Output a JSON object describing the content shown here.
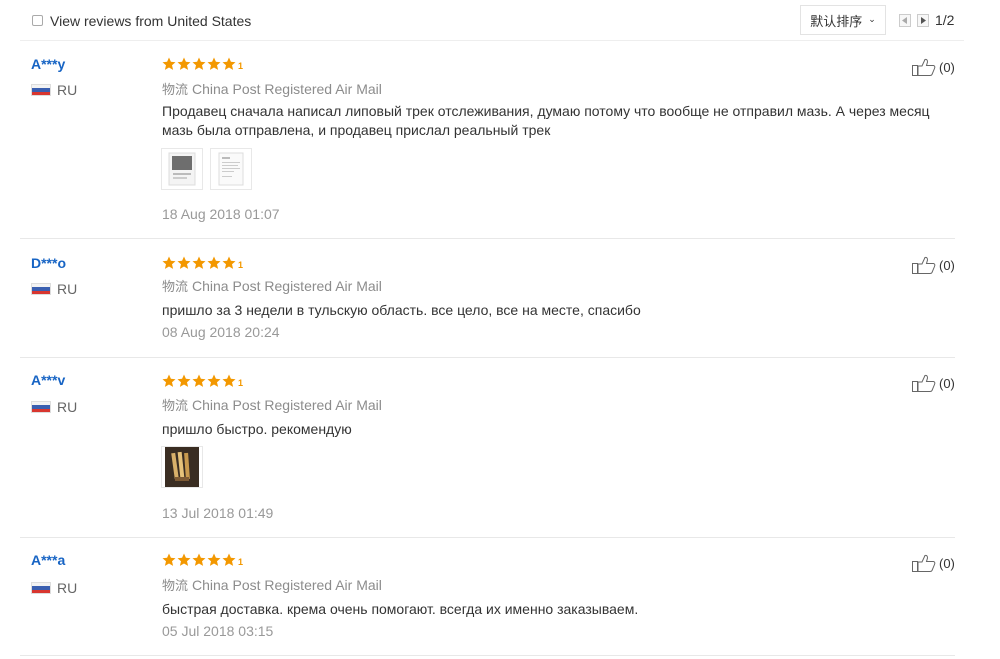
{
  "filter": {
    "label": "View reviews from United States",
    "checked": false
  },
  "sort": {
    "label": "默认排序"
  },
  "pagination": {
    "text": "1/2"
  },
  "logistics_prefix": "物流",
  "reviews": [
    {
      "user": "A***y",
      "country": "RU",
      "rating": 5,
      "logistics": "China Post Registered Air Mail",
      "text_line1": "Продавец сначала написал липовый трек отслеживания, думаю потому что вообще не отправил мазь. А через месяц",
      "text_line2": "мазь была отправлена, и продавец прислал реальный трек",
      "date": "18 Aug 2018 01:07",
      "likes": "(0)",
      "photos": 2
    },
    {
      "user": "D***o",
      "country": "RU",
      "rating": 5,
      "logistics": "China Post Registered Air Mail",
      "text_line1": "пришло за 3 недели в тульскую область. все цело, все на месте, спасибо",
      "date": "08 Aug 2018 20:24",
      "likes": "(0)",
      "photos": 0
    },
    {
      "user": "A***v",
      "country": "RU",
      "rating": 5,
      "logistics": "China Post Registered Air Mail",
      "text_line1": "пришло быстро. рекомендую",
      "date": "13 Jul 2018 01:49",
      "likes": "(0)",
      "photos": 1
    },
    {
      "user": "A***a",
      "country": "RU",
      "rating": 5,
      "logistics": "China Post Registered Air Mail",
      "text_line1": "быстрая доставка. крема очень помогают. всегда их именно заказываем.",
      "date": "05 Jul 2018 03:15",
      "likes": "(0)",
      "photos": 0
    }
  ],
  "colors": {
    "username": "#1764c4",
    "star": "#f39800",
    "muted": "#999999"
  }
}
